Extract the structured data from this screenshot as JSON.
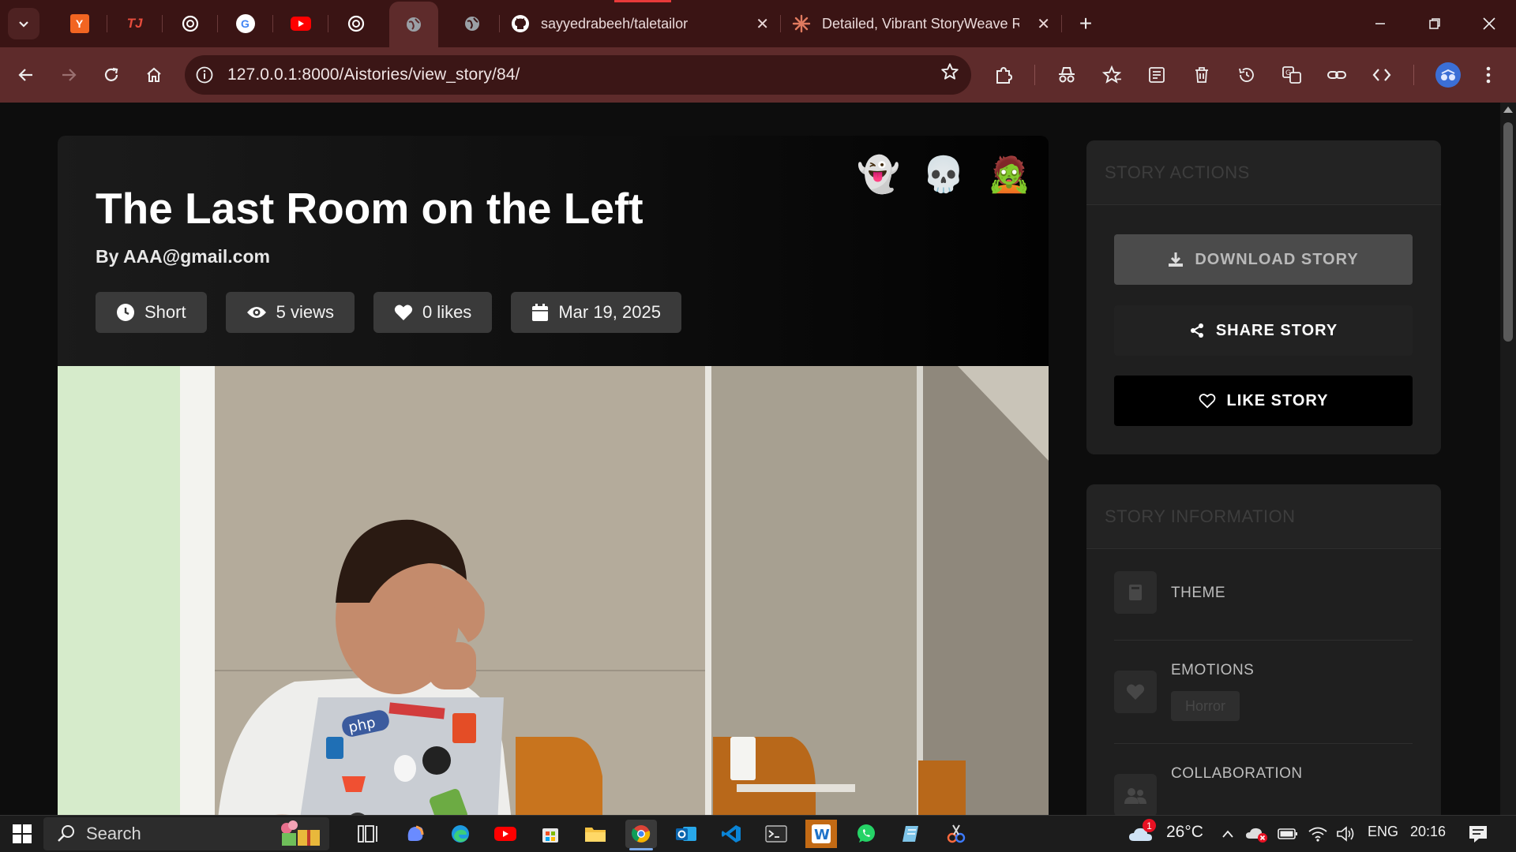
{
  "browser": {
    "tabs": [
      {
        "title": "sayyedrabeeh/taletailor",
        "icon": "github-icon"
      },
      {
        "title": "Detailed, Vibrant StoryWeave R",
        "icon": "claude-icon"
      }
    ],
    "mini_tabs": [
      {
        "icon": "y-combinator-icon",
        "letter": "Y",
        "color": "#f26522"
      },
      {
        "icon": "tj-icon",
        "letter": "TJ",
        "color": "#c0392b"
      },
      {
        "icon": "chatgpt-icon",
        "letter": "",
        "color": "#ffffff"
      },
      {
        "icon": "google-icon",
        "letter": "G",
        "color": "#ffffff"
      },
      {
        "icon": "youtube-icon",
        "letter": "",
        "color": "#ff0000"
      },
      {
        "icon": "chatgpt-icon",
        "letter": "",
        "color": "#ffffff"
      },
      {
        "icon": "globe-icon",
        "letter": "",
        "color": "#cccccc"
      },
      {
        "icon": "globe-icon",
        "letter": "",
        "color": "#cccccc"
      }
    ],
    "url": "127.0.0.1:8000/Aistories/view_story/84/",
    "accent_color": "#5e2b2b"
  },
  "story": {
    "title": "The Last Room on the Left",
    "author": "By AAA@gmail.com",
    "emojis": [
      "👻",
      "💀",
      "🧟"
    ],
    "meta": {
      "length": "Short",
      "views": "5 views",
      "likes": "0 likes",
      "date": "Mar 19, 2025"
    }
  },
  "sidebar": {
    "actions": {
      "title": "STORY ACTIONS",
      "download_label": "DOWNLOAD STORY",
      "share_label": "SHARE STORY",
      "like_label": "LIKE STORY"
    },
    "information": {
      "title": "STORY INFORMATION",
      "theme_label": "THEME",
      "emotions_label": "EMOTIONS",
      "emotion_chip": "Horror",
      "collaboration_label": "COLLABORATION"
    }
  },
  "taskbar": {
    "search_label": "Search",
    "weather": "26°C",
    "language": "ENG",
    "time": "20:16",
    "weather_badge": "1"
  }
}
